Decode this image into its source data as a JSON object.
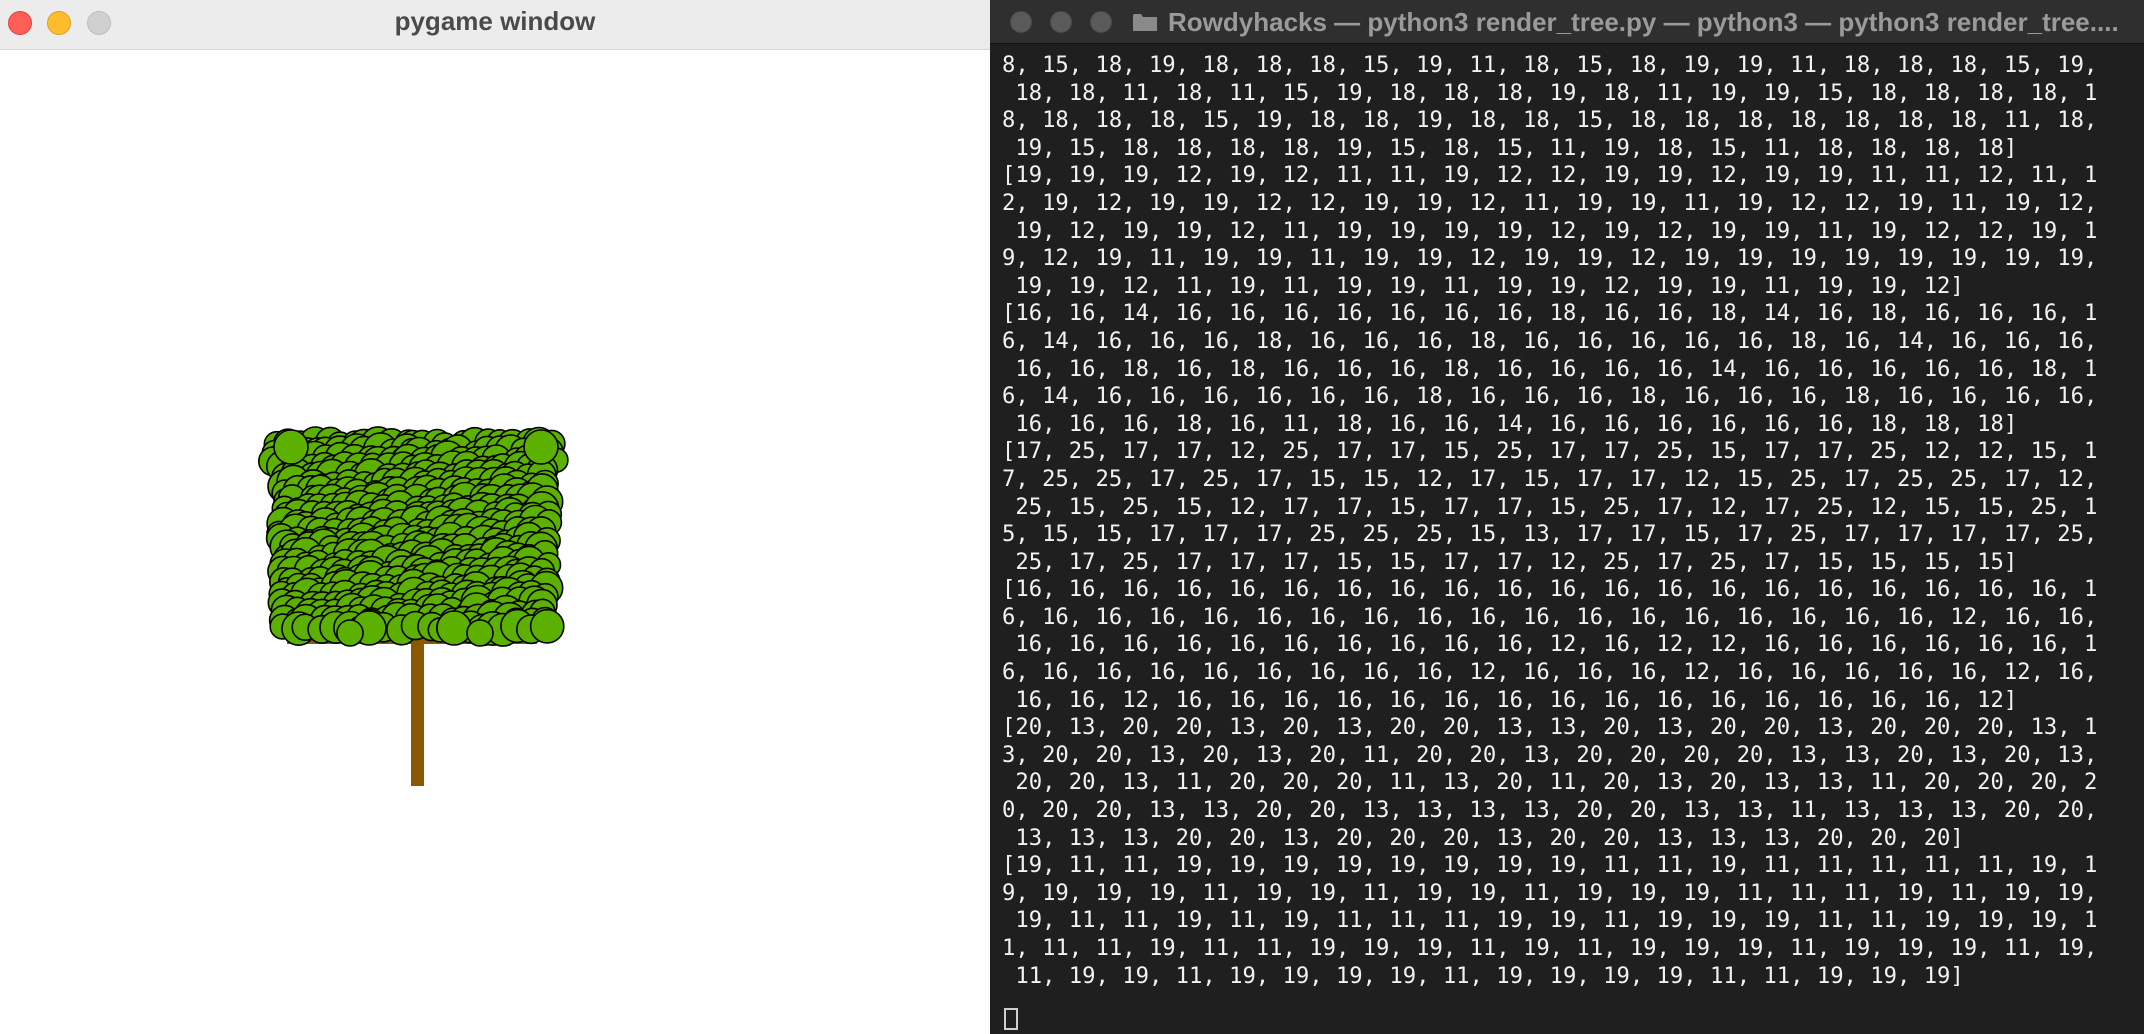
{
  "pygame_window": {
    "title": "pygame window"
  },
  "tree": {
    "trunk_color": "#8b5a00",
    "leaf_color": "#5cb000",
    "leaf_outline": "#000000"
  },
  "terminal": {
    "title": "Rowdyhacks — python3 render_tree.py — python3 — python3 render_tree....",
    "lines": [
      "8, 15, 18, 19, 18, 18, 18, 15, 19, 11, 18, 15, 18, 19, 19, 11, 18, 18, 18, 15, 19,",
      " 18, 18, 11, 18, 11, 15, 19, 18, 18, 18, 19, 18, 11, 19, 19, 15, 18, 18, 18, 18, 1",
      "8, 18, 18, 18, 15, 19, 18, 18, 19, 18, 18, 15, 18, 18, 18, 18, 18, 18, 18, 11, 18,",
      " 19, 15, 18, 18, 18, 18, 19, 15, 18, 15, 11, 19, 18, 15, 11, 18, 18, 18, 18]",
      "[19, 19, 19, 12, 19, 12, 11, 11, 19, 12, 12, 19, 19, 12, 19, 19, 11, 11, 12, 11, 1",
      "2, 19, 12, 19, 19, 12, 12, 19, 19, 12, 11, 19, 19, 11, 19, 12, 12, 19, 11, 19, 12,",
      " 19, 12, 19, 19, 12, 11, 19, 19, 19, 19, 12, 19, 12, 19, 19, 11, 19, 12, 12, 19, 1",
      "9, 12, 19, 11, 19, 19, 11, 19, 19, 12, 19, 19, 12, 19, 19, 19, 19, 19, 19, 19, 19,",
      " 19, 19, 12, 11, 19, 11, 19, 19, 11, 19, 19, 12, 19, 19, 11, 19, 19, 12]",
      "[16, 16, 14, 16, 16, 16, 16, 16, 16, 16, 18, 16, 16, 18, 14, 16, 18, 16, 16, 16, 1",
      "6, 14, 16, 16, 16, 18, 16, 16, 16, 18, 16, 16, 16, 16, 16, 18, 16, 14, 16, 16, 16,",
      " 16, 16, 18, 16, 18, 16, 16, 16, 18, 16, 16, 16, 16, 14, 16, 16, 16, 16, 16, 18, 1",
      "6, 14, 16, 16, 16, 16, 16, 16, 18, 16, 16, 16, 18, 16, 16, 16, 18, 16, 16, 16, 16,",
      " 16, 16, 16, 18, 16, 11, 18, 16, 16, 14, 16, 16, 16, 16, 16, 16, 18, 18, 18]",
      "[17, 25, 17, 17, 12, 25, 17, 17, 15, 25, 17, 17, 25, 15, 17, 17, 25, 12, 12, 15, 1",
      "7, 25, 25, 17, 25, 17, 15, 15, 12, 17, 15, 17, 17, 12, 15, 25, 17, 25, 25, 17, 12,",
      " 25, 15, 25, 15, 12, 17, 17, 15, 17, 17, 15, 25, 17, 12, 17, 25, 12, 15, 15, 25, 1",
      "5, 15, 15, 17, 17, 17, 25, 25, 25, 15, 13, 17, 17, 15, 17, 25, 17, 17, 17, 17, 25,",
      " 25, 17, 25, 17, 17, 17, 15, 15, 17, 17, 12, 25, 17, 25, 17, 15, 15, 15, 15]",
      "[16, 16, 16, 16, 16, 16, 16, 16, 16, 16, 16, 16, 16, 16, 16, 16, 16, 16, 16, 16, 1",
      "6, 16, 16, 16, 16, 16, 16, 16, 16, 16, 16, 16, 16, 16, 16, 16, 16, 16, 12, 16, 16,",
      " 16, 16, 16, 16, 16, 16, 16, 16, 16, 16, 12, 16, 12, 12, 16, 16, 16, 16, 16, 16, 1",
      "6, 16, 16, 16, 16, 16, 16, 16, 16, 12, 16, 16, 16, 12, 16, 16, 16, 16, 16, 12, 16,",
      " 16, 16, 12, 16, 16, 16, 16, 16, 16, 16, 16, 16, 16, 16, 16, 16, 16, 16, 12]",
      "[20, 13, 20, 20, 13, 20, 13, 20, 20, 13, 13, 20, 13, 20, 20, 13, 20, 20, 20, 13, 1",
      "3, 20, 20, 13, 20, 13, 20, 11, 20, 20, 13, 20, 20, 20, 20, 13, 13, 20, 13, 20, 13,",
      " 20, 20, 13, 11, 20, 20, 20, 11, 13, 20, 11, 20, 13, 20, 13, 13, 11, 20, 20, 20, 2",
      "0, 20, 20, 13, 13, 20, 20, 13, 13, 13, 13, 20, 20, 13, 13, 11, 13, 13, 13, 20, 20,",
      " 13, 13, 13, 20, 20, 13, 20, 20, 20, 13, 20, 20, 13, 13, 13, 20, 20, 20]",
      "[19, 11, 11, 19, 19, 19, 19, 19, 19, 19, 19, 11, 11, 19, 11, 11, 11, 11, 11, 19, 1",
      "9, 19, 19, 19, 11, 19, 19, 11, 19, 19, 11, 19, 19, 19, 11, 11, 11, 19, 11, 19, 19,",
      " 19, 11, 11, 19, 11, 19, 11, 11, 11, 19, 19, 11, 19, 19, 19, 11, 11, 19, 19, 19, 1",
      "1, 11, 11, 19, 11, 11, 19, 19, 19, 11, 19, 11, 19, 19, 19, 11, 19, 19, 19, 11, 19,",
      " 11, 19, 19, 11, 19, 19, 19, 19, 11, 19, 19, 19, 19, 11, 11, 19, 19, 19]"
    ]
  }
}
